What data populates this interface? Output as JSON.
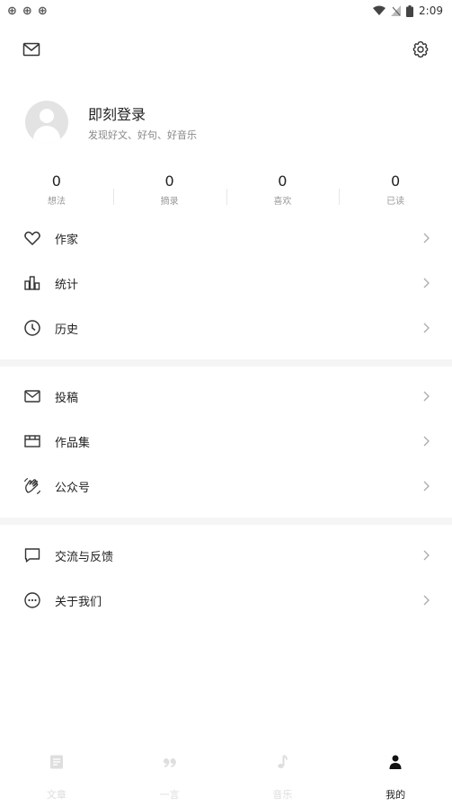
{
  "status_bar": {
    "left_icons": [
      "notification-icon",
      "notification-icon",
      "notification-icon"
    ],
    "time": "2:09"
  },
  "profile": {
    "title": "即刻登录",
    "subtitle": "发现好文、好句、好音乐"
  },
  "stats": [
    {
      "value": "0",
      "label": "想法"
    },
    {
      "value": "0",
      "label": "摘录"
    },
    {
      "value": "0",
      "label": "喜欢"
    },
    {
      "value": "0",
      "label": "已读"
    }
  ],
  "menu_group_1": [
    {
      "label": "作家",
      "icon": "heart-icon"
    },
    {
      "label": "统计",
      "icon": "bar-chart-icon"
    },
    {
      "label": "历史",
      "icon": "clock-icon"
    }
  ],
  "menu_group_2": [
    {
      "label": "投稿",
      "icon": "mail-icon"
    },
    {
      "label": "作品集",
      "icon": "collection-icon"
    },
    {
      "label": "公众号",
      "icon": "wechat-icon"
    }
  ],
  "menu_group_3": [
    {
      "label": "交流与反馈",
      "icon": "message-icon"
    },
    {
      "label": "关于我们",
      "icon": "more-icon"
    }
  ],
  "tabs": [
    {
      "label": "文章",
      "icon": "article-icon",
      "active": false
    },
    {
      "label": "一言",
      "icon": "quote-icon",
      "active": false
    },
    {
      "label": "音乐",
      "icon": "music-note-icon",
      "active": false
    },
    {
      "label": "我的",
      "icon": "person-icon",
      "active": true
    }
  ],
  "colors": {
    "text": "#222222",
    "muted": "#888888",
    "divider": "#f5f5f5",
    "tab_inactive": "#dcdcdc"
  }
}
